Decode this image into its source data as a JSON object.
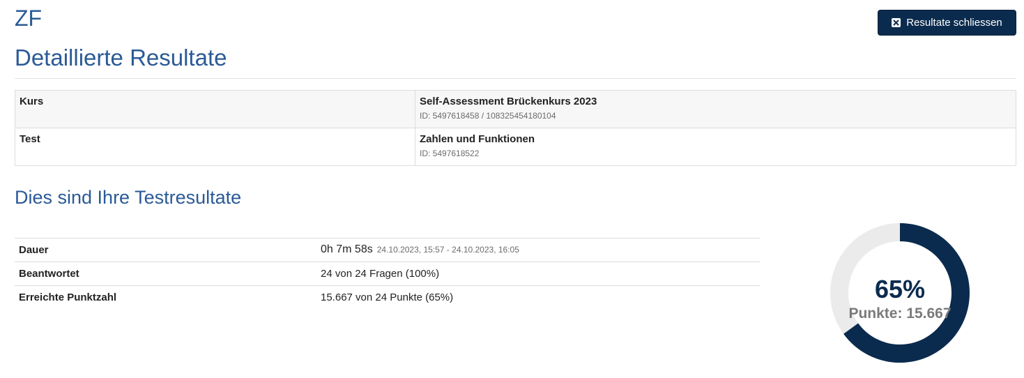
{
  "header": {
    "title": "ZF",
    "close_button_label": "Resultate schliessen",
    "close_icon": "close-box-icon"
  },
  "heading": "Detaillierte Resultate",
  "info_table": {
    "rows": [
      {
        "label": "Kurs",
        "value": "Self-Assessment Brückenkurs 2023",
        "id": "ID: 5497618458 / 108325454180104"
      },
      {
        "label": "Test",
        "value": "Zahlen und Funktionen",
        "id": "ID: 5497618522"
      }
    ]
  },
  "results": {
    "heading": "Dies sind Ihre Testresultate",
    "rows": [
      {
        "label": "Dauer",
        "value": "0h 7m 58s",
        "detail": "24.10.2023, 15:57 - 24.10.2023, 16:05"
      },
      {
        "label": "Beantwortet",
        "value": "24 von 24 Fragen (100%)"
      },
      {
        "label": "Erreichte Punktzahl",
        "value": "15.667 von 24 Punkte (65%)"
      }
    ]
  },
  "gauge": {
    "percent_label": "65%",
    "points_label": "Punkte: 15.667",
    "fraction": 0.65,
    "colors": {
      "fill": "#0b2b4e",
      "track": "#ebebeb"
    }
  }
}
